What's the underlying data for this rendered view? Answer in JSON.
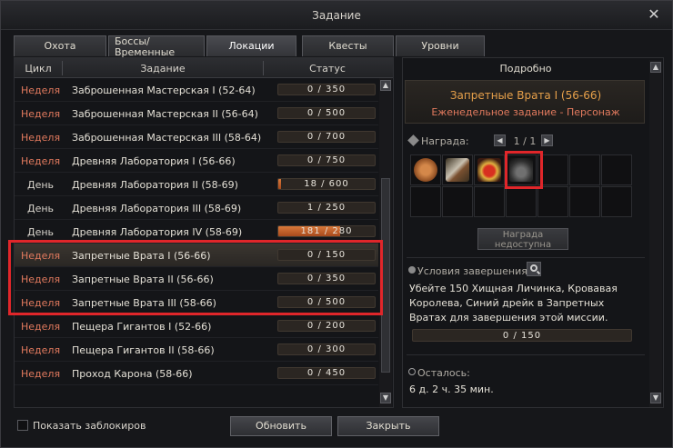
{
  "window": {
    "title": "Задание",
    "close_label": "✕"
  },
  "tabs": [
    {
      "label": "Охота"
    },
    {
      "label": "Боссы/ Временные Зоны"
    },
    {
      "label": "Локации",
      "active": true
    },
    {
      "label": "Квесты"
    },
    {
      "label": "Уровни"
    }
  ],
  "table": {
    "headers": {
      "cycle": "Цикл",
      "task": "Задание",
      "status": "Статус"
    },
    "rows": [
      {
        "cycle": "Неделя",
        "type": "week",
        "name": "Заброшенная Мастерская I (52-64)",
        "status": "0 / 350",
        "progress": 0
      },
      {
        "cycle": "Неделя",
        "type": "week",
        "name": "Заброшенная Мастерская II (56-64)",
        "status": "0 / 500",
        "progress": 0
      },
      {
        "cycle": "Неделя",
        "type": "week",
        "name": "Заброшенная Мастерская III (58-64)",
        "status": "0 / 700",
        "progress": 0
      },
      {
        "cycle": "Неделя",
        "type": "week",
        "name": "Древняя Лаборатория I (56-66)",
        "status": "0 / 750",
        "progress": 0
      },
      {
        "cycle": "День",
        "type": "day",
        "name": "Древняя Лаборатория II (58-69)",
        "status": "18 / 600",
        "progress": 0.03
      },
      {
        "cycle": "День",
        "type": "day",
        "name": "Древняя Лаборатория III (58-69)",
        "status": "1 / 250",
        "progress": 0.004
      },
      {
        "cycle": "День",
        "type": "day",
        "name": "Древняя Лаборатория IV (58-69)",
        "status": "181 / 280",
        "progress": 0.646
      },
      {
        "cycle": "Неделя",
        "type": "week",
        "name": "Запретные Врата I (56-66)",
        "status": "0 / 150",
        "progress": 0,
        "selected": true
      },
      {
        "cycle": "Неделя",
        "type": "week",
        "name": "Запретные Врата II (56-66)",
        "status": "0 / 350",
        "progress": 0
      },
      {
        "cycle": "Неделя",
        "type": "week",
        "name": "Запретные Врата III (58-66)",
        "status": "0 / 500",
        "progress": 0
      },
      {
        "cycle": "Неделя",
        "type": "week",
        "name": "Пещера Гигантов I (52-66)",
        "status": "0 / 200",
        "progress": 0
      },
      {
        "cycle": "Неделя",
        "type": "week",
        "name": "Пещера Гигантов II (58-66)",
        "status": "0 / 300",
        "progress": 0
      },
      {
        "cycle": "Неделя",
        "type": "week",
        "name": "Проход Карона (58-66)",
        "status": "0 / 450",
        "progress": 0
      }
    ]
  },
  "details": {
    "heading": "Подробно",
    "quest_name": "Запретные Врата I (56-66)",
    "quest_sub": "Еженедельное задание - Персонаж",
    "reward_label": "Награда:",
    "reward_page": "1 / 1",
    "reward_button": "Награда недоступна",
    "conditions_label": "Условия завершения:",
    "conditions_text": "Убейте 150 Хищная Личинка, Кровавая Королева, Синий дрейк в Запретных Вратах для завершения этой миссии.",
    "progress_text": "0 / 150",
    "remaining_label": "Осталось:",
    "remaining_value": "6 д. 2 ч. 35 мин.",
    "reward_items": [
      "bronze-coin-icon",
      "scroll-icon",
      "potion-icon",
      "bag-icon"
    ]
  },
  "footer": {
    "show_locked": "Показать заблокиров",
    "refresh": "Обновить",
    "close": "Закрыть"
  },
  "colors": {
    "week": "#e27a5e",
    "quest_title": "#e6a04a",
    "highlight": "#e0262a",
    "progress_fill": "#d9783a"
  }
}
